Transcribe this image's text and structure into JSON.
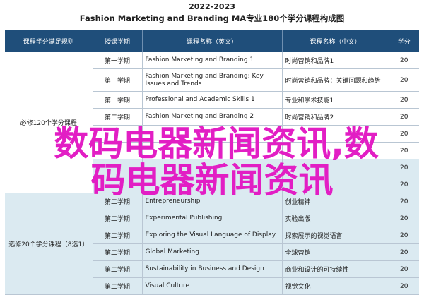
{
  "header": {
    "year": "2022-2023",
    "title": "Fashion Marketing and Branding MA专业180个学分课程构成图"
  },
  "columns": [
    "课程学分满足规则",
    "授课学期",
    "课程名称（英文）",
    "课程名称（中文）",
    "学分"
  ],
  "groups": [
    {
      "label": "必修120个学分课程"
    },
    {
      "label": "选修20个学分课程（8选1）"
    }
  ],
  "rows": [
    {
      "term": "第一学期",
      "en": "Fashion Marketing and Branding 1",
      "cn": "时尚营销和品牌1",
      "credit": "20"
    },
    {
      "term": "第一学期",
      "en": "Fashion Marketing and Branding: Key Issues and Trends",
      "cn": "时尚营销和品牌：关键问题和趋势",
      "credit": "20"
    },
    {
      "term": "第一学期",
      "en": "Professional and Academic Skills 1",
      "cn": "专业和学术技能1",
      "credit": "20"
    },
    {
      "term": "第二学期",
      "en": "Fashion Marketing and Branding 2",
      "cn": "时尚营销和品牌2",
      "credit": "20"
    },
    {
      "term": "",
      "en": "",
      "cn": "",
      "credit": "20"
    },
    {
      "term": "",
      "en": "",
      "cn": "",
      "credit": "20"
    },
    {
      "term": "",
      "en": "",
      "cn": "",
      "credit": "20"
    },
    {
      "term": "",
      "en": "",
      "cn": "",
      "credit": "20"
    },
    {
      "term": "第二学期",
      "en": "Entrepreneurship",
      "cn": "创业精神",
      "credit": "20"
    },
    {
      "term": "第二学期",
      "en": "Experimental Publishing",
      "cn": "实验出版",
      "credit": "20"
    },
    {
      "term": "第二学期",
      "en": "Exploring the Visual Language of Display",
      "cn": "探索展示的视觉语言",
      "credit": "20"
    },
    {
      "term": "第二学期",
      "en": "Global Marketing",
      "cn": "全球营销",
      "credit": "20"
    },
    {
      "term": "第二学期",
      "en": "Sustainability in Business and Design",
      "cn": "商业和设计的可持续性",
      "credit": "20"
    },
    {
      "term": "第二学期",
      "en": "Visual Culture",
      "cn": "视觉文化",
      "credit": "20"
    }
  ],
  "overlay": {
    "line1": "数码电器新闻资讯,数",
    "line2": "码电器新闻资讯"
  }
}
